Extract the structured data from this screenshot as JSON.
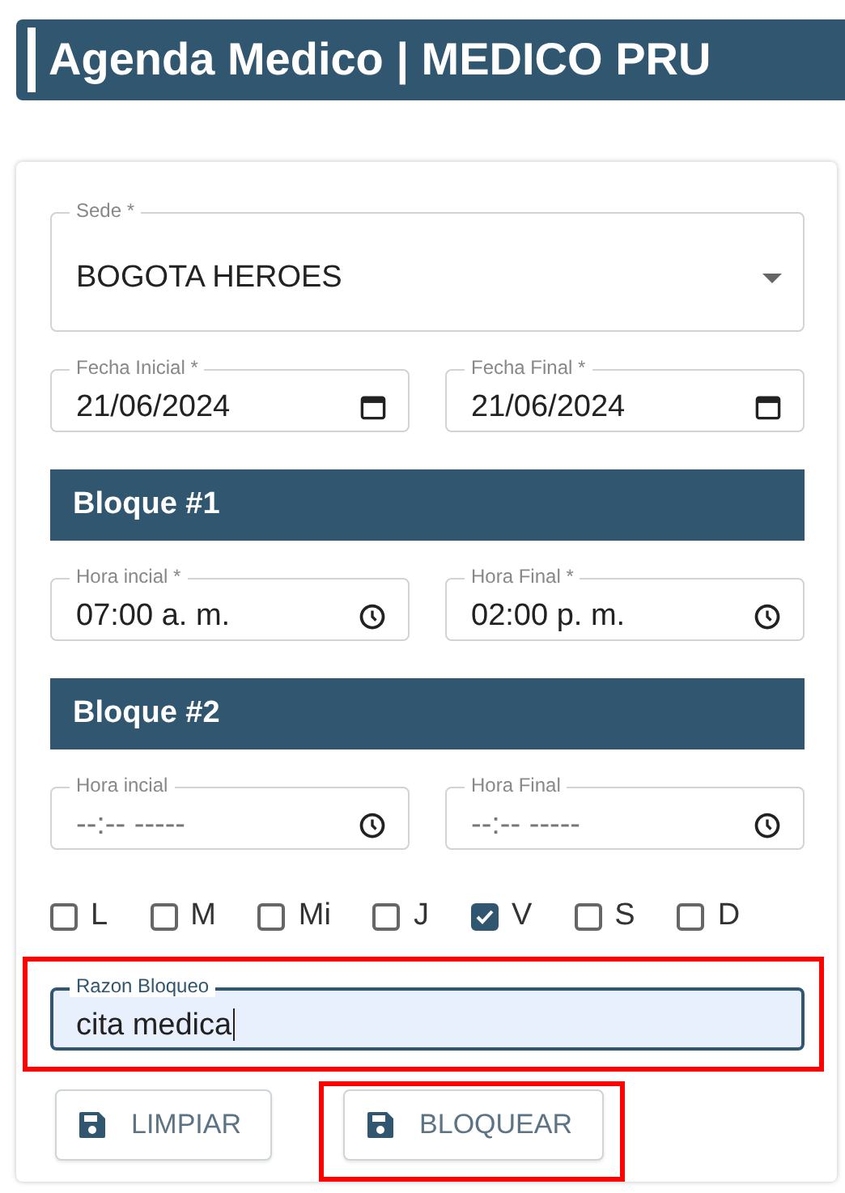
{
  "header": {
    "title": "Agenda Medico | MEDICO PRU"
  },
  "sede": {
    "label": "Sede *",
    "value": "BOGOTA HEROES"
  },
  "dates": [
    {
      "label": "Fecha Inicial *",
      "value": "21/06/2024"
    },
    {
      "label": "Fecha Final *",
      "value": "21/06/2024"
    }
  ],
  "blocks": [
    {
      "title": "Bloque #1",
      "fields": [
        {
          "label": "Hora incial *",
          "value": "07:00 a. m."
        },
        {
          "label": "Hora Final *",
          "value": "02:00 p. m."
        }
      ]
    },
    {
      "title": "Bloque #2",
      "fields": [
        {
          "label": "Hora incial",
          "placeholder": "--:-- -----"
        },
        {
          "label": "Hora Final",
          "placeholder": "--:-- -----"
        }
      ]
    }
  ],
  "days": [
    {
      "label": "L",
      "checked": false
    },
    {
      "label": "M",
      "checked": false
    },
    {
      "label": "Mi",
      "checked": false
    },
    {
      "label": "J",
      "checked": false
    },
    {
      "label": "V",
      "checked": true
    },
    {
      "label": "S",
      "checked": false
    },
    {
      "label": "D",
      "checked": false
    }
  ],
  "reason": {
    "label": "Razon Bloqueo",
    "value": "cita medica",
    "focused": true,
    "highlighted": true
  },
  "buttons": [
    {
      "label": "LIMPIAR",
      "highlighted": false
    },
    {
      "label": "BLOQUEAR",
      "highlighted": true
    }
  ]
}
